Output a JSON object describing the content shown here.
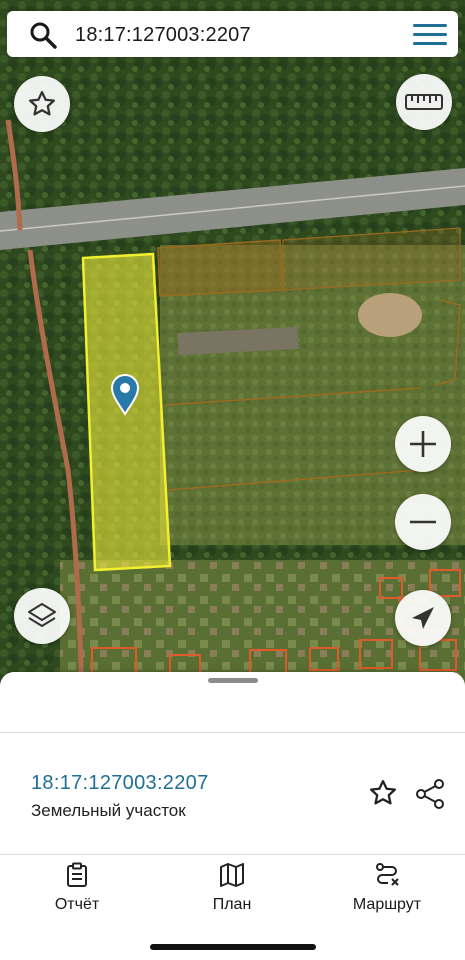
{
  "search": {
    "query": "18:17:127003:2207"
  },
  "map": {
    "selected_parcel_color": "#e8e63a",
    "neighbor_parcel_color": "#9a6b1e",
    "building_outline_color": "#e05a2a",
    "marker_color": "#2979a8"
  },
  "controls": {
    "favorite_icon": "star-outline-icon",
    "ruler_icon": "ruler-icon",
    "zoom_in_icon": "plus-icon",
    "zoom_out_icon": "minus-icon",
    "layers_icon": "layers-icon",
    "locate_icon": "navigation-arrow-icon"
  },
  "sheet": {
    "parcel_id": "18:17:127003:2207",
    "parcel_type": "Земельный участок",
    "accent_color": "#1f6f96"
  },
  "nav": {
    "report_label": "Отчёт",
    "plan_label": "План",
    "route_label": "Маршрут"
  }
}
